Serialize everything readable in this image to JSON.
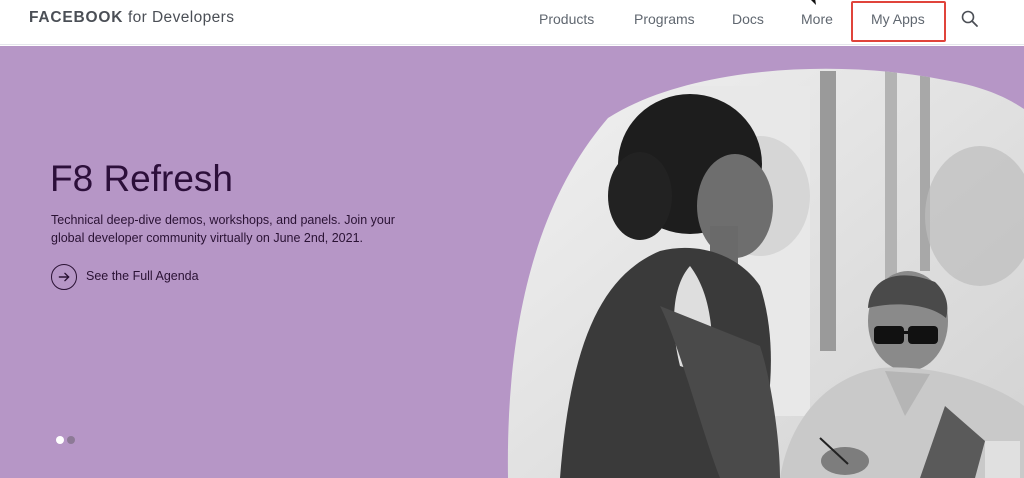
{
  "header": {
    "brand_bold": "FACEBOOK",
    "brand_rest": " for Developers",
    "nav": {
      "products": "Products",
      "programs": "Programs",
      "docs": "Docs",
      "more": "More",
      "my_apps": "My Apps"
    },
    "search_icon": "search-icon",
    "highlight_color": "#e0443b"
  },
  "hero": {
    "title": "F8 Refresh",
    "description": "Technical deep-dive demos, workshops, and panels. Join your global developer community virtually on June 2nd, 2021.",
    "cta_label": "See the Full Agenda",
    "cta_icon": "arrow-right-icon",
    "background_color": "#b696c6",
    "title_color": "#2c0f3a",
    "carousel": {
      "slide_count": 2,
      "active_slide": 1
    }
  }
}
